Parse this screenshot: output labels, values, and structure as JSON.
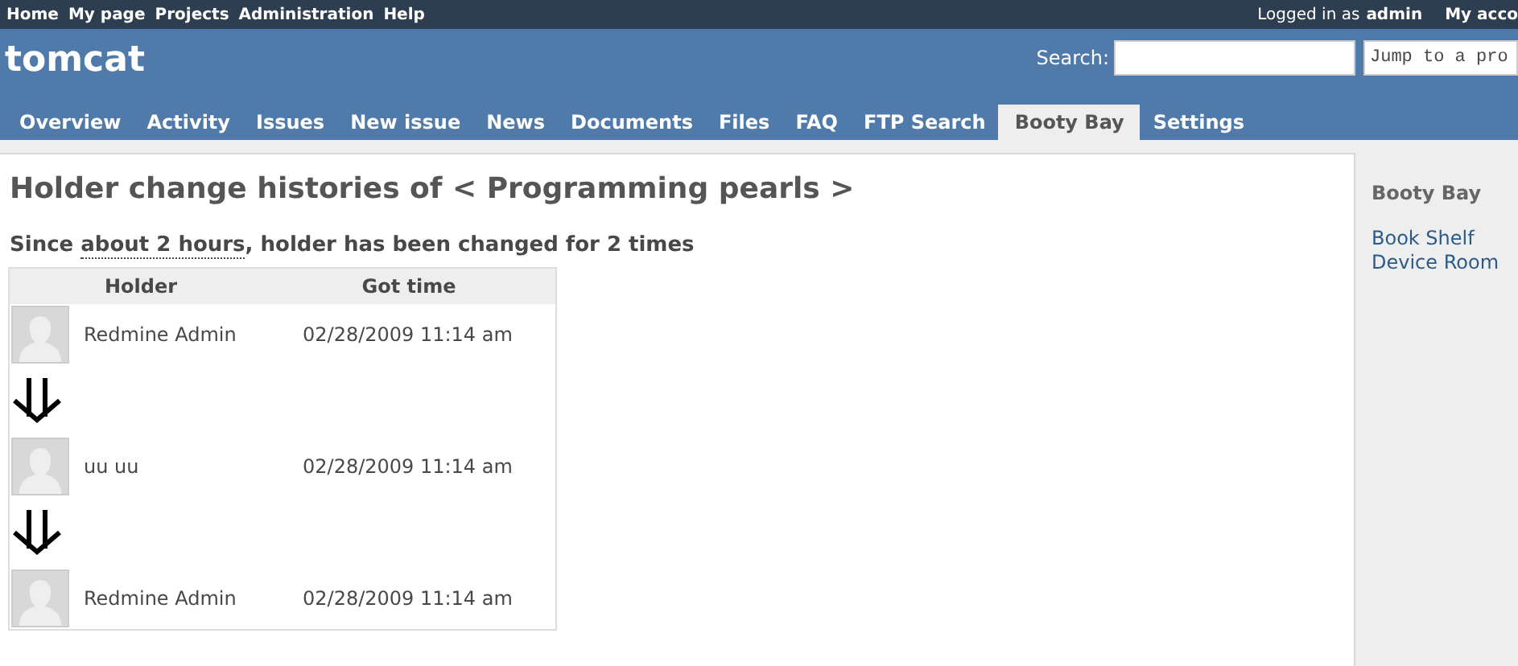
{
  "top_menu": [
    "Home",
    "My page",
    "Projects",
    "Administration",
    "Help"
  ],
  "account": {
    "logged_in_as": "Logged in as",
    "user": "admin",
    "my_account": "My acco"
  },
  "header": {
    "project": "tomcat",
    "search_label": "Search:",
    "jump_to": "Jump to a pro"
  },
  "tabs": [
    {
      "label": "Overview",
      "selected": false
    },
    {
      "label": "Activity",
      "selected": false
    },
    {
      "label": "Issues",
      "selected": false
    },
    {
      "label": "New issue",
      "selected": false
    },
    {
      "label": "News",
      "selected": false
    },
    {
      "label": "Documents",
      "selected": false
    },
    {
      "label": "Files",
      "selected": false
    },
    {
      "label": "FAQ",
      "selected": false
    },
    {
      "label": "FTP Search",
      "selected": false
    },
    {
      "label": "Booty Bay",
      "selected": true
    },
    {
      "label": "Settings",
      "selected": false
    }
  ],
  "main": {
    "heading": "Holder change histories of < Programming pearls >",
    "summary": {
      "before": "Since ",
      "link": "about 2 hours",
      "after": ", holder has been changed for 2 times"
    },
    "table": {
      "columns": [
        "Holder",
        "Got time"
      ],
      "rows": [
        {
          "holder": "Redmine Admin",
          "got_time": "02/28/2009 11:14 am"
        },
        {
          "holder": "uu uu",
          "got_time": "02/28/2009 11:14 am"
        },
        {
          "holder": "Redmine Admin",
          "got_time": "02/28/2009 11:14 am"
        }
      ]
    }
  },
  "sidebar": {
    "heading": "Booty Bay",
    "links": [
      "Book Shelf",
      "Device Room"
    ]
  }
}
